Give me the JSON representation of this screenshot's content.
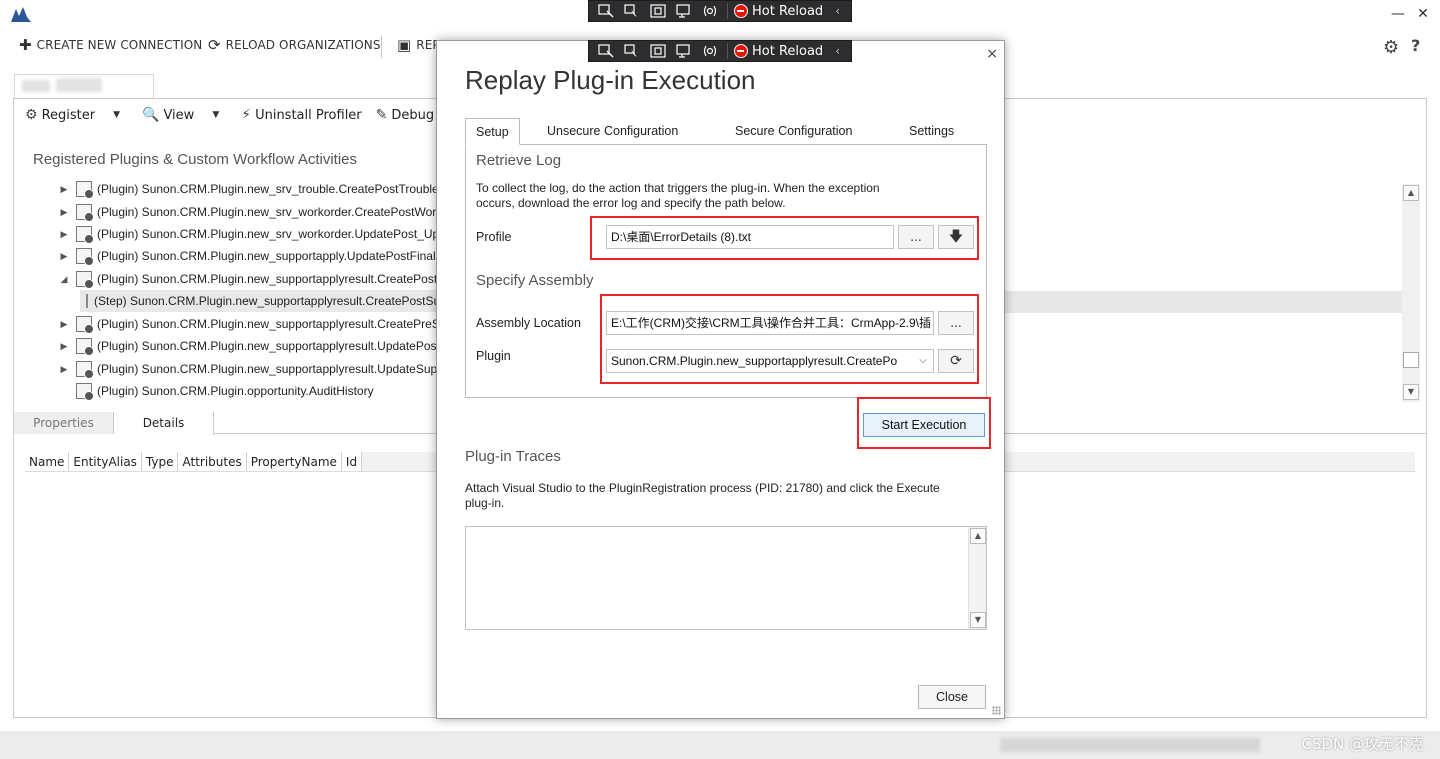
{
  "devbar": {
    "hot_reload": "Hot Reload"
  },
  "toolbar": {
    "create_connection": "CREATE NEW CONNECTION",
    "reload_organizations": "RELOAD ORGANIZATIONS",
    "truncated_item": "REP"
  },
  "subtoolbar": {
    "register": "Register",
    "view": "View",
    "uninstall_profiler": "Uninstall Profiler",
    "debug": "Debug"
  },
  "section_title": "Registered Plugins & Custom Workflow Activities",
  "tree": [
    {
      "text": "(Plugin) Sunon.CRM.Plugin.new_srv_trouble.CreatePostTrouble",
      "expander": "▶"
    },
    {
      "text": "(Plugin) Sunon.CRM.Plugin.new_srv_workorder.CreatePostWorkorder",
      "expander": "▶"
    },
    {
      "text": "(Plugin) Sunon.CRM.Plugin.new_srv_workorder.UpdatePost_Update",
      "expander": "▶"
    },
    {
      "text": "(Plugin) Sunon.CRM.Plugin.new_supportapply.UpdatePostFinalresult",
      "expander": "▶"
    },
    {
      "text": "(Plugin) Sunon.CRM.Plugin.new_supportapplyresult.CreatePostSupport",
      "expander": "◢"
    },
    {
      "text": "(Step) Sunon.CRM.Plugin.new_supportapplyresult.CreatePostSupport",
      "expander": ""
    },
    {
      "text": "(Plugin) Sunon.CRM.Plugin.new_supportapplyresult.CreatePreSupport",
      "expander": "▶"
    },
    {
      "text": "(Plugin) Sunon.CRM.Plugin.new_supportapplyresult.UpdatePostSupport",
      "expander": "▶"
    },
    {
      "text": "(Plugin) Sunon.CRM.Plugin.new_supportapplyresult.UpdateSupport",
      "expander": "▶"
    },
    {
      "text": "(Plugin) Sunon.CRM.Plugin.opportunity.AuditHistory",
      "expander": ""
    }
  ],
  "prop_tabs": {
    "properties": "Properties",
    "details": "Details"
  },
  "grid_columns": [
    "Name",
    "EntityAlias",
    "Type",
    "Attributes",
    "PropertyName",
    "Id"
  ],
  "watermark": "CSDN @攻无不克",
  "dialog": {
    "title": "Replay Plug-in Execution",
    "close_glyph": "×",
    "tabs": [
      "Setup",
      "Unsecure Configuration",
      "Secure Configuration",
      "Settings"
    ],
    "retrieve_log": {
      "title": "Retrieve Log",
      "desc_line1": "To collect the log, do the action that triggers the plug-in. When the exception",
      "desc_line2": "occurs, download the error log and specify the path below.",
      "profile_label": "Profile",
      "profile_value": "D:\\桌面\\ErrorDetails (8).txt",
      "browse_label": "...",
      "download_glyph": "🡇"
    },
    "specify_assembly": {
      "title": "Specify Assembly",
      "assembly_label": "Assembly Location",
      "assembly_value": "E:\\工作(CRM)交接\\CRM工具\\操作合并工具：CrmApp-2.9\\插",
      "browse_label": "...",
      "plugin_label": "Plugin",
      "plugin_value": "Sunon.CRM.Plugin.new_supportapplyresult.CreatePo",
      "refresh_glyph": "⟳"
    },
    "start_execution": "Start Execution",
    "traces": {
      "title": "Plug-in Traces",
      "desc_line1": "Attach Visual Studio to the PluginRegistration process (PID: 21780) and click the Execute",
      "desc_line2": "plug-in."
    },
    "close_button": "Close"
  },
  "colors": {
    "highlight_red": "#e8252b",
    "primary_border": "#5b9bd5",
    "devbar_bg": "#2d2d30"
  }
}
